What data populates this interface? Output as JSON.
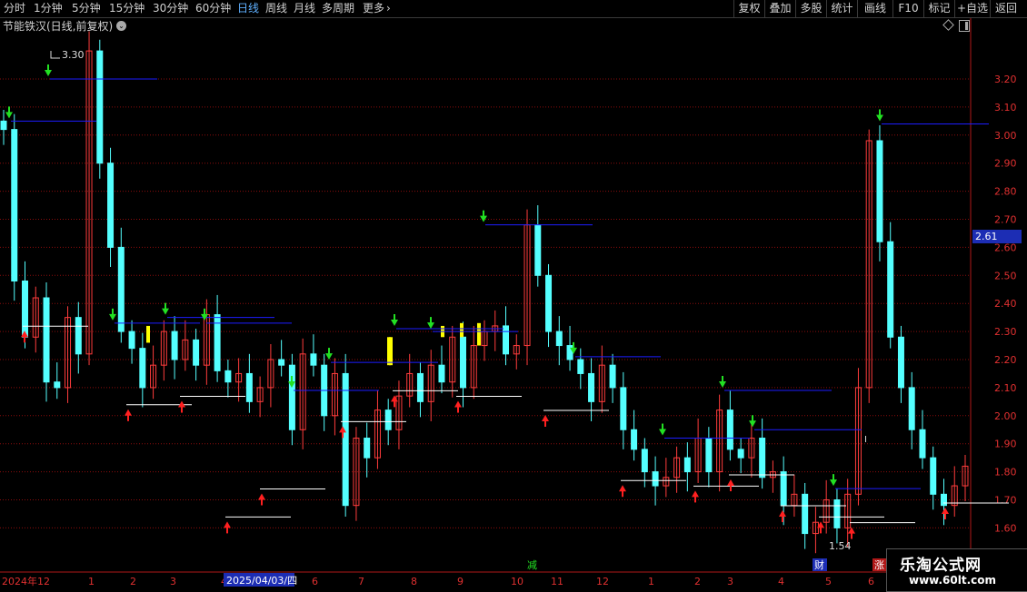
{
  "toolbar": {
    "left_items": [
      "分时",
      "1分钟",
      "5分钟",
      "15分钟",
      "30分钟",
      "60分钟",
      "日线",
      "周线",
      "月线",
      "多周期",
      "更多"
    ],
    "active_index": 6,
    "more_icon": "chevron-right-icon",
    "right_items": [
      "复权",
      "叠加",
      "多股",
      "统计",
      "画线",
      "F10",
      "标记",
      "+自选",
      "返回"
    ]
  },
  "title": {
    "stock_title": "节能铁汉(日线,前复权)",
    "dropdown_icon": "chevron-down-icon"
  },
  "price_badge": "2.61",
  "annotations": {
    "high_label": "3.30",
    "low_label": "1.54",
    "cursor_mark": "I"
  },
  "markers": {
    "jian": "减",
    "cai": "财",
    "zhang": "涨"
  },
  "date_highlight": "2025/04/03/四",
  "colors": {
    "up": "#ff3c3c",
    "down": "#54ffff",
    "grid": "#8a0c0c",
    "axis": "#b01818",
    "resistance": "#1d1dff",
    "support": "#ffffff",
    "sell_arrow": "#22e022",
    "buy_arrow": "#ff2020",
    "highlight": "#ffff00",
    "date_box": "#1c2db4"
  },
  "watermark": {
    "line1": "乐淘公式网",
    "line2": "www.60lt.com"
  },
  "chart_data": {
    "type": "candlestick",
    "title": "节能铁汉(日线,前复权)",
    "y_axis": {
      "ticks": [
        3.2,
        3.1,
        3.0,
        2.9,
        2.8,
        2.7,
        2.6,
        2.5,
        2.4,
        2.3,
        2.2,
        2.1,
        2.0,
        1.9,
        1.8,
        1.7,
        1.6
      ],
      "ylim": [
        1.5,
        3.3
      ]
    },
    "x_axis": {
      "labels": [
        "2024年",
        "12",
        "1",
        "2",
        "3",
        "4",
        "5",
        "6",
        "7",
        "8",
        "9",
        "10",
        "11",
        "12",
        "1",
        "2",
        "3",
        "4",
        "5",
        "6"
      ]
    },
    "current_price": 2.61,
    "max_label": 3.3,
    "min_label": 1.54,
    "grid": true,
    "series": [
      {
        "name": "close",
        "values": [
          3.02,
          2.48,
          2.28,
          2.42,
          2.12,
          2.1,
          2.35,
          2.22,
          3.3,
          2.9,
          2.6,
          2.3,
          2.24,
          2.1,
          2.18,
          2.3,
          2.2,
          2.27,
          2.18,
          2.36,
          2.16,
          2.12,
          2.15,
          2.05,
          2.1,
          2.2,
          2.18,
          1.95,
          2.22,
          2.18,
          2.0,
          2.15,
          1.68,
          1.92,
          1.85,
          2.02,
          1.95,
          2.07,
          2.15,
          2.05,
          2.18,
          2.12,
          2.28,
          2.1,
          2.25,
          2.3,
          2.32,
          2.22,
          2.25,
          2.68,
          2.5,
          2.3,
          2.25,
          2.2,
          2.15,
          2.05,
          2.18,
          2.1,
          1.95,
          1.88,
          1.8,
          1.75,
          1.78,
          1.85,
          1.8,
          1.92,
          1.8,
          2.02,
          1.88,
          1.85,
          1.92,
          1.78,
          1.8,
          1.68,
          1.72,
          1.58,
          1.62,
          1.7,
          1.6,
          1.72,
          2.1,
          2.98,
          2.62,
          2.28,
          2.1,
          1.95,
          1.85,
          1.72,
          1.68,
          1.75,
          1.82
        ],
        "sell_signals": [
          3.05,
          3.2,
          2.33,
          2.35,
          2.33,
          2.19,
          2.09,
          2.31,
          2.3,
          2.68,
          2.21,
          2.09,
          1.92,
          1.95,
          1.74,
          3.04
        ],
        "buy_signals": [
          2.28,
          2.0,
          2.03,
          1.6,
          1.7,
          1.94,
          2.05,
          2.03,
          1.98,
          1.73,
          1.71,
          1.75,
          1.64,
          1.6,
          1.58,
          1.65
        ]
      }
    ]
  }
}
